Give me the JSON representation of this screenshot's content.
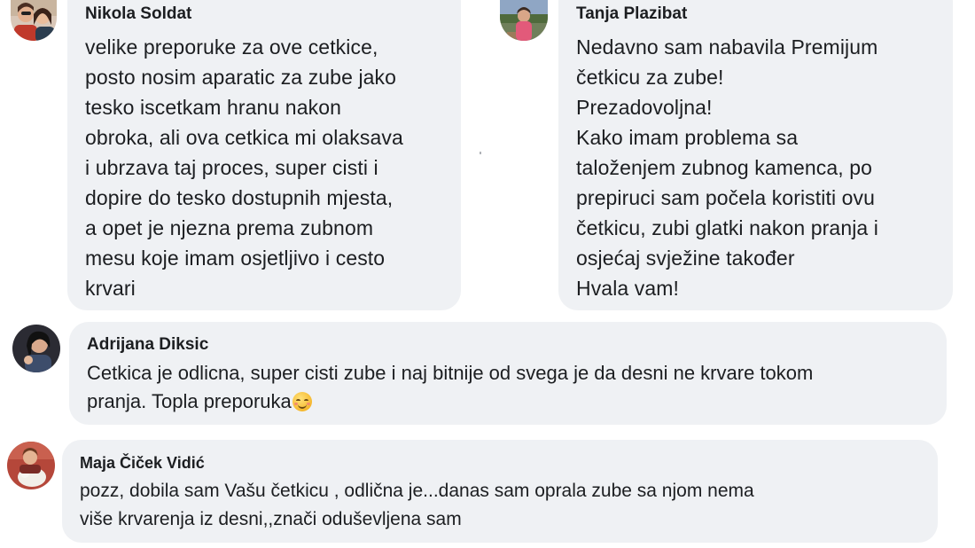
{
  "comments": [
    {
      "author": "Nikola Soldat",
      "text": "velike preporuke za ove cetkice,\nposto nosim aparatic za zube jako\ntesko iscetkam hranu nakon\nobroka, ali ova cetkica mi olaksava\ni ubrzava taj proces, super cisti i\ndopire do tesko dostupnih mjesta,\na opet je njezna prema zubnom\nmesu koje imam osjetljivo i cesto\nkrvari",
      "avatar_icon": "couple-photo-avatar"
    },
    {
      "author": "Tanja Plazibat",
      "text": "Nedavno sam nabavila Premijum\nčetkicu za zube!\nPrezadovoljna!\nKako imam problema sa\ntaloženjem zubnog kamenca, po\nprepiruci sam počela koristiti ovu\nčetkicu, zubi glatki nakon pranja i\nosjećaj svježine također\nHvala vam!",
      "avatar_icon": "outdoor-photo-avatar"
    },
    {
      "author": "Adrijana Diksic",
      "text": "Cetkica je odlicna, super cisti zube i naj bitnije od svega je da desni ne krvare tokom\npranja. Topla preporuka",
      "emoji": "smiling-blush-emoji",
      "avatar_icon": "portrait-photo-avatar"
    },
    {
      "author": "Maja Čiček Vidić",
      "text": "pozz, dobila sam Vašu četkicu , odlična je...danas sam oprala zube sa njom nema\nviše krvarenja iz desni,,znači oduševljena sam",
      "avatar_icon": "pet-photo-avatar"
    }
  ],
  "colors": {
    "bubble_bg": "#eff1f4",
    "text": "#1c1e21",
    "page_bg": "#ffffff"
  }
}
